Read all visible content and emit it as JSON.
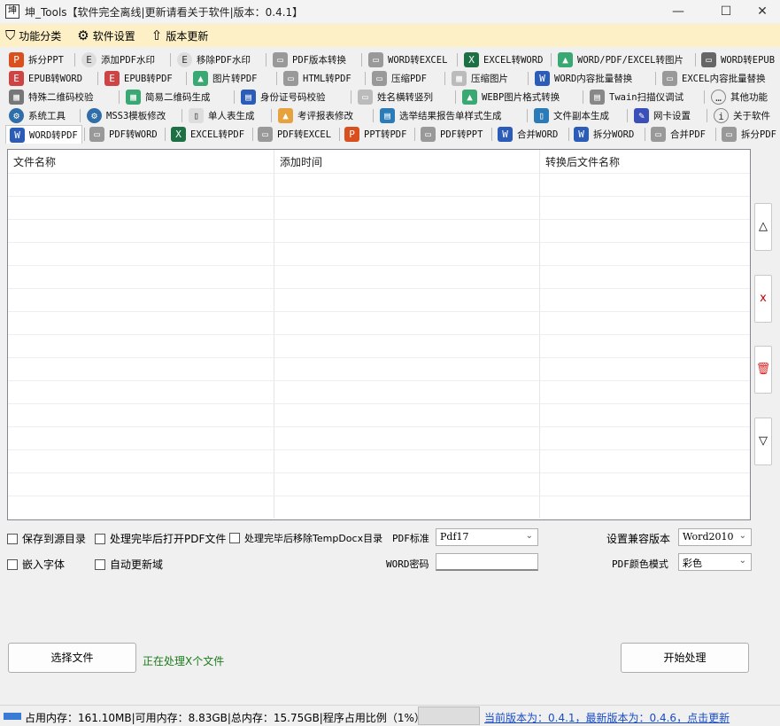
{
  "window": {
    "title": "坤_Tools【软件完全离线|更新请看关于软件|版本：0.4.1】",
    "minimize_glyph": "—",
    "maximize_glyph": "☐",
    "close_glyph": "✕"
  },
  "menu": {
    "items": [
      {
        "label": "功能分类",
        "icon": "shield-icon"
      },
      {
        "label": "软件设置",
        "icon": "gear-icon"
      },
      {
        "label": "版本更新",
        "icon": "up-arrow-icon"
      }
    ]
  },
  "tabs": {
    "row1": [
      "拆分PPT",
      "添加PDF水印",
      "移除PDF水印",
      "PDF版本转换",
      "WORD转EXCEL",
      "EXCEL转WORD",
      "WORD/PDF/EXCEL转图片",
      "WORD转EPUB"
    ],
    "row2": [
      "EPUB转WORD",
      "EPUB转PDF",
      "图片转PDF",
      "HTML转PDF",
      "压缩PDF",
      "压缩图片",
      "WORD内容批量替换",
      "EXCEL内容批量替换"
    ],
    "row3": [
      "特殊二维码校验",
      "简易二维码生成",
      "身份证号码校验",
      "姓名横转竖列",
      "WEBP图片格式转换",
      "Twain扫描仪调试",
      "其他功能"
    ],
    "row4": [
      "系统工具",
      "MSS3模板修改",
      "单人表生成",
      "考评报表修改",
      "选举结果报告单样式生成",
      "文件副本生成",
      "网卡设置",
      "关于软件"
    ],
    "row5": [
      "WORD转PDF",
      "PDF转WORD",
      "EXCEL转PDF",
      "PDF转EXCEL",
      "PPT转PDF",
      "PDF转PPT",
      "合并WORD",
      "拆分WORD",
      "合并PDF",
      "拆分PDF"
    ]
  },
  "table": {
    "columns": [
      "文件名称",
      "添加时间",
      "转换后文件名称"
    ],
    "rows": []
  },
  "side_buttons": [
    "△",
    "x",
    "▯",
    "▽"
  ],
  "options": {
    "save_to_source": "保存到源目录",
    "open_after": "处理完毕后打开PDF文件",
    "remove_temp": "处理完毕后移除TempDocx目录",
    "embed_font": "嵌入字体",
    "auto_update_field": "自动更新域",
    "pdf_standard_label": "PDF标准",
    "pdf_standard_value": "Pdf17",
    "word_password_label": "WORD密码",
    "compat_label": "设置兼容版本",
    "compat_value": "Word2010",
    "color_mode_label": "PDF颜色模式",
    "color_mode_value": "彩色"
  },
  "actions": {
    "select_file": "选择文件",
    "processing_text": "正在处理X个文件",
    "start": "开始处理"
  },
  "status": {
    "memory": "占用内存：161.10MB|可用内存：8.83GB|总内存：15.75GB|程序占用比例（1%）",
    "version": "当前版本为：0.4.1，最新版本为：0.4.6，点击更新"
  }
}
